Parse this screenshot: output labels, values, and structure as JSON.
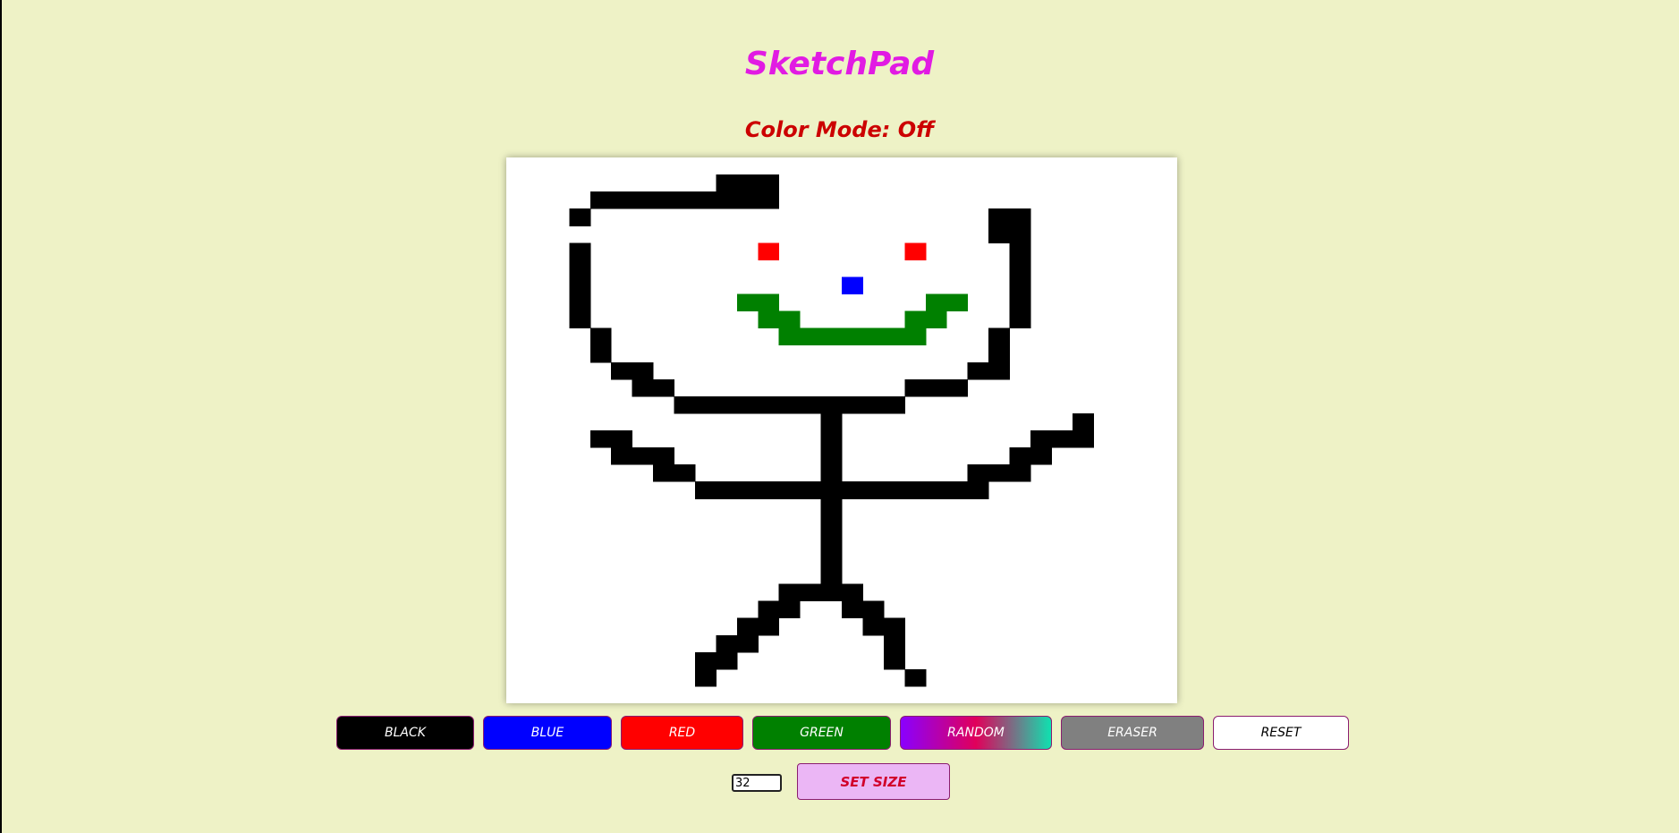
{
  "app": {
    "title": "SketchPad",
    "color_mode_text": "Color Mode: Off"
  },
  "grid": {
    "size_value": "32"
  },
  "drawing": {
    "segments": [
      {
        "color": "#000000",
        "cells": [
          [
            10,
            2,
            13,
            1
          ],
          [
            4,
            3,
            13,
            2
          ],
          [
            3,
            4,
            4,
            3
          ],
          [
            23,
            4,
            25,
            3
          ],
          [
            23,
            5,
            25,
            4
          ],
          [
            3,
            6,
            4,
            5
          ],
          [
            24,
            6,
            25,
            5
          ],
          [
            3,
            8,
            4,
            6
          ],
          [
            24,
            8,
            25,
            6
          ],
          [
            3,
            10,
            4,
            8
          ],
          [
            24,
            10,
            25,
            8
          ],
          [
            4,
            11,
            5,
            10
          ],
          [
            23,
            11,
            24,
            10
          ],
          [
            4,
            12,
            5,
            11
          ],
          [
            23,
            12,
            24,
            11
          ],
          [
            5,
            13,
            7,
            12
          ],
          [
            22,
            13,
            24,
            12
          ],
          [
            6,
            14,
            8,
            13
          ],
          [
            19,
            14,
            22,
            13
          ],
          [
            8,
            15,
            13,
            14
          ],
          [
            13,
            15,
            19,
            14
          ],
          [
            15,
            21,
            16,
            15
          ],
          [
            27,
            16,
            28,
            15
          ],
          [
            4,
            17,
            6,
            16
          ],
          [
            25,
            17,
            28,
            16
          ],
          [
            5,
            18,
            8,
            17
          ],
          [
            24,
            18,
            26,
            17
          ],
          [
            7,
            19,
            9,
            18
          ],
          [
            22,
            19,
            25,
            18
          ],
          [
            9,
            20,
            23,
            19
          ],
          [
            15,
            25,
            16,
            20
          ],
          [
            13,
            26,
            17,
            25
          ],
          [
            12,
            27,
            14,
            26
          ],
          [
            16,
            27,
            18,
            26
          ],
          [
            11,
            28,
            13,
            27
          ],
          [
            17,
            28,
            19,
            27
          ],
          [
            10,
            29,
            12,
            28
          ],
          [
            18,
            29,
            19,
            28
          ],
          [
            9,
            30,
            11,
            29
          ],
          [
            18,
            30,
            19,
            29
          ],
          [
            9,
            31,
            10,
            30
          ],
          [
            19,
            31,
            20,
            30
          ]
        ]
      },
      {
        "color": "#ff0000",
        "cells": [
          [
            12,
            6,
            13,
            5
          ],
          [
            19,
            6,
            20,
            5
          ]
        ]
      },
      {
        "color": "#0000ff",
        "cells": [
          [
            16,
            8,
            17,
            7
          ]
        ]
      },
      {
        "color": "#008000",
        "cells": [
          [
            11,
            9,
            13,
            8
          ],
          [
            20,
            9,
            22,
            8
          ],
          [
            12,
            10,
            14,
            9
          ],
          [
            19,
            10,
            21,
            9
          ],
          [
            13,
            11,
            20,
            10
          ]
        ]
      }
    ]
  },
  "buttons": [
    {
      "id": "black",
      "label": "BLACK",
      "bg": "#000000",
      "fg": "#ffffff"
    },
    {
      "id": "blue",
      "label": "BLUE",
      "bg": "#0000ff",
      "fg": "#ffffff"
    },
    {
      "id": "red",
      "label": "RED",
      "bg": "#ff0000",
      "fg": "#ffffff"
    },
    {
      "id": "green",
      "label": "GREEN",
      "bg": "#008000",
      "fg": "#ffffff"
    },
    {
      "id": "random",
      "label": "RANDOM",
      "bg": "linear-gradient(90deg,#8a00ff,#e1005a,#0fe1b0)",
      "fg": "#ffffff"
    },
    {
      "id": "eraser",
      "label": "ERASER",
      "bg": "#808080",
      "fg": "#ffffff"
    },
    {
      "id": "reset",
      "label": "RESET",
      "bg": "#ffffff",
      "fg": "#000000"
    }
  ],
  "set_size_label": "SET SIZE"
}
